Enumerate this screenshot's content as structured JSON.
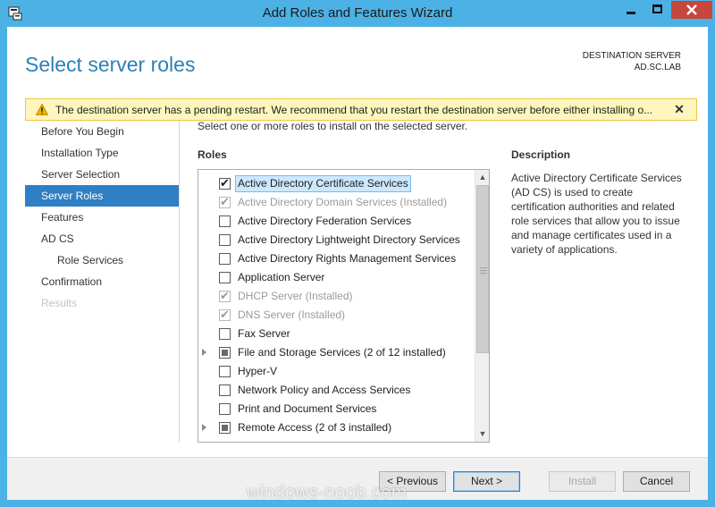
{
  "window": {
    "title": "Add Roles and Features Wizard",
    "accent_color": "#4cb2e5",
    "close_color": "#c7463d",
    "app_icon": "server-manager-icon"
  },
  "header": {
    "page_title": "Select server roles",
    "destination_label": "DESTINATION SERVER",
    "destination_value": "AD.SC.LAB"
  },
  "warning": {
    "icon": "warning-triangle-icon",
    "text": "The destination server has a pending restart. We recommend that you restart the destination server before either installing o...",
    "close_glyph": "✕",
    "background": "#fef6bc"
  },
  "nav": {
    "items": [
      {
        "label": "Before You Begin",
        "state": "normal"
      },
      {
        "label": "Installation Type",
        "state": "normal"
      },
      {
        "label": "Server Selection",
        "state": "normal"
      },
      {
        "label": "Server Roles",
        "state": "active"
      },
      {
        "label": "Features",
        "state": "normal"
      },
      {
        "label": "AD CS",
        "state": "normal"
      },
      {
        "label": "Role Services",
        "state": "sub"
      },
      {
        "label": "Confirmation",
        "state": "normal"
      },
      {
        "label": "Results",
        "state": "disabled"
      }
    ],
    "active_color": "#2f7fc4"
  },
  "main": {
    "instruction": "Select one or more roles to install on the selected server.",
    "roles_label": "Roles",
    "roles": [
      {
        "label": "Active Directory Certificate Services",
        "checked": true,
        "disabled": false,
        "selected": true,
        "expandable": false,
        "partial": false
      },
      {
        "label": "Active Directory Domain Services (Installed)",
        "checked": true,
        "disabled": true,
        "selected": false,
        "expandable": false,
        "partial": false
      },
      {
        "label": "Active Directory Federation Services",
        "checked": false,
        "disabled": false,
        "selected": false,
        "expandable": false,
        "partial": false
      },
      {
        "label": "Active Directory Lightweight Directory Services",
        "checked": false,
        "disabled": false,
        "selected": false,
        "expandable": false,
        "partial": false
      },
      {
        "label": "Active Directory Rights Management Services",
        "checked": false,
        "disabled": false,
        "selected": false,
        "expandable": false,
        "partial": false
      },
      {
        "label": "Application Server",
        "checked": false,
        "disabled": false,
        "selected": false,
        "expandable": false,
        "partial": false
      },
      {
        "label": "DHCP Server (Installed)",
        "checked": true,
        "disabled": true,
        "selected": false,
        "expandable": false,
        "partial": false
      },
      {
        "label": "DNS Server (Installed)",
        "checked": true,
        "disabled": true,
        "selected": false,
        "expandable": false,
        "partial": false
      },
      {
        "label": "Fax Server",
        "checked": false,
        "disabled": false,
        "selected": false,
        "expandable": false,
        "partial": false
      },
      {
        "label": "File and Storage Services (2 of 12 installed)",
        "checked": false,
        "disabled": false,
        "selected": false,
        "expandable": true,
        "partial": true
      },
      {
        "label": "Hyper-V",
        "checked": false,
        "disabled": false,
        "selected": false,
        "expandable": false,
        "partial": false
      },
      {
        "label": "Network Policy and Access Services",
        "checked": false,
        "disabled": false,
        "selected": false,
        "expandable": false,
        "partial": false
      },
      {
        "label": "Print and Document Services",
        "checked": false,
        "disabled": false,
        "selected": false,
        "expandable": false,
        "partial": false
      },
      {
        "label": "Remote Access (2 of 3 installed)",
        "checked": false,
        "disabled": false,
        "selected": false,
        "expandable": true,
        "partial": true
      }
    ],
    "description_label": "Description",
    "description_text": "Active Directory Certificate Services (AD CS) is used to create certification authorities and related role services that allow you to issue and manage certificates used in a variety of applications."
  },
  "footer": {
    "previous_label": "< Previous",
    "next_label": "Next >",
    "install_label": "Install",
    "cancel_label": "Cancel"
  },
  "watermark": "windows-noob.com"
}
